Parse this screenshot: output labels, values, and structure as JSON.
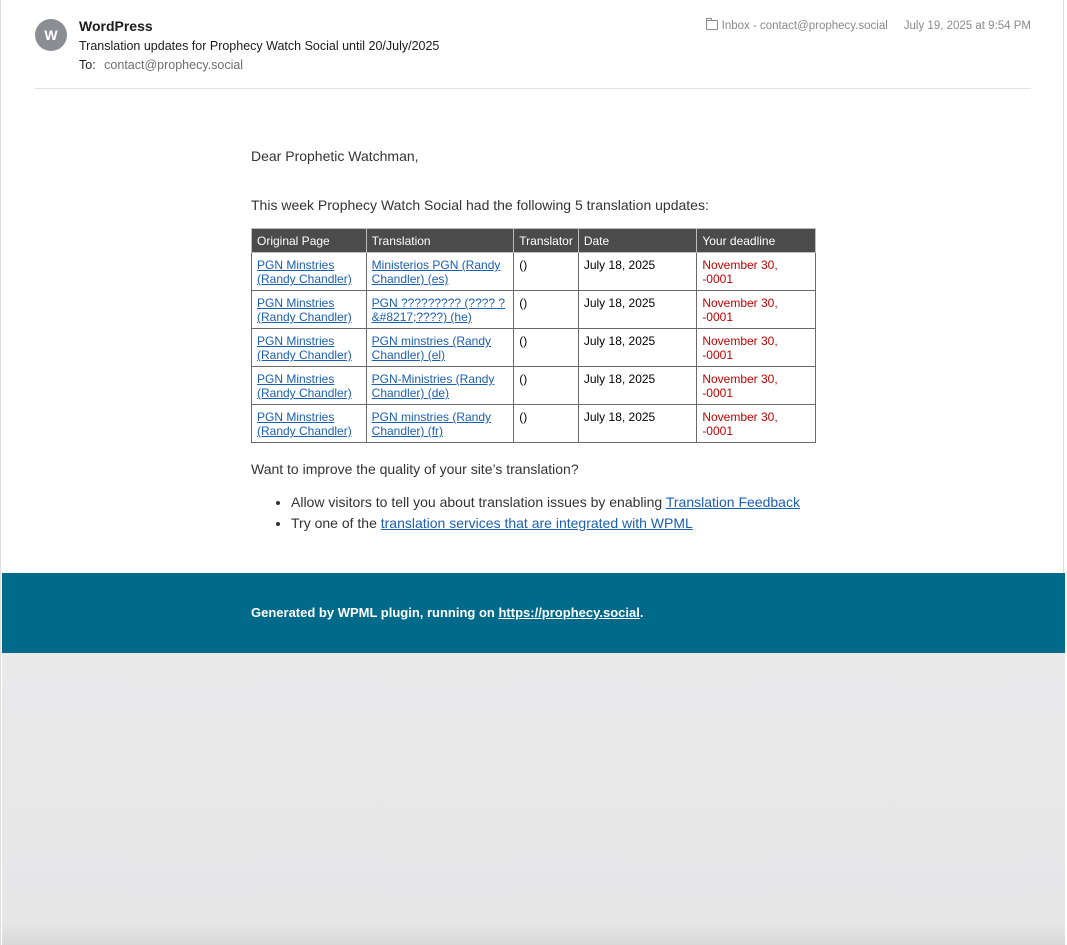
{
  "header": {
    "avatar_letter": "W",
    "sender": "WordPress",
    "subject": "Translation updates for Prophecy Watch Social until 20/July/2025",
    "to_label": "To:",
    "to_address": "contact@prophecy.social",
    "mailbox": "Inbox - contact@prophecy.social",
    "date": "July 19, 2025 at 9:54 PM"
  },
  "body": {
    "greeting": "Dear Prophetic Watchman,",
    "intro": "This week Prophecy Watch Social had the following 5 translation updates:",
    "table": {
      "headers": [
        "Original Page",
        "Translation",
        "Translator",
        "Date",
        "Your deadline"
      ],
      "rows": [
        {
          "original": "PGN Minstries (Randy Chandler)",
          "translation": "Ministerios PGN (Randy Chandler) (es)",
          "translator": "()",
          "date": "July 18, 2025",
          "deadline": "November 30, -0001"
        },
        {
          "original": "PGN Minstries (Randy Chandler)",
          "translation": "PGN ????????? (???? ? &#8217;????) (he)",
          "translator": "()",
          "date": "July 18, 2025",
          "deadline": "November 30, -0001"
        },
        {
          "original": "PGN Minstries (Randy Chandler)",
          "translation": "PGN minstries (Randy Chandler) (el)",
          "translator": "()",
          "date": "July 18, 2025",
          "deadline": "November 30, -0001"
        },
        {
          "original": "PGN Minstries (Randy Chandler)",
          "translation": "PGN-Ministries (Randy Chandler) (de)",
          "translator": "()",
          "date": "July 18, 2025",
          "deadline": "November 30, -0001"
        },
        {
          "original": "PGN Minstries (Randy Chandler)",
          "translation": "PGN minstries (Randy Chandler) (fr)",
          "translator": "()",
          "date": "July 18, 2025",
          "deadline": "November 30, -0001"
        }
      ]
    },
    "improve": "Want to improve the quality of your site’s translation?",
    "tips": [
      {
        "text": "Allow visitors to tell you about translation issues by enabling ",
        "link": "Translation Feedback"
      },
      {
        "text": "Try one of the ",
        "link": "translation services that are integrated with WPML"
      }
    ]
  },
  "footer": {
    "text": "Generated by WPML plugin, running on ",
    "link": "https://prophecy.social",
    "suffix": ".",
    "color": "#006a8a"
  }
}
